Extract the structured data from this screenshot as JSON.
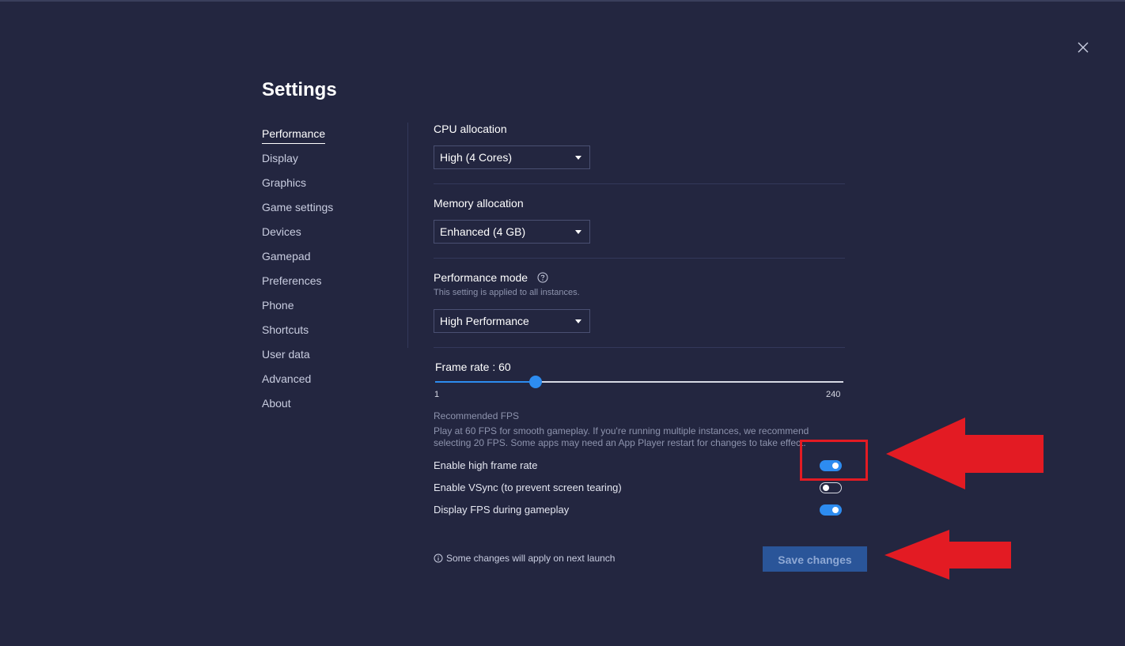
{
  "window": {
    "title": "Settings",
    "close_icon": "close-icon"
  },
  "sidebar": {
    "items": [
      {
        "label": "Performance",
        "active": true
      },
      {
        "label": "Display"
      },
      {
        "label": "Graphics"
      },
      {
        "label": "Game settings"
      },
      {
        "label": "Devices"
      },
      {
        "label": "Gamepad"
      },
      {
        "label": "Preferences"
      },
      {
        "label": "Phone"
      },
      {
        "label": "Shortcuts"
      },
      {
        "label": "User data"
      },
      {
        "label": "Advanced"
      },
      {
        "label": "About"
      }
    ]
  },
  "performance": {
    "cpu": {
      "label": "CPU allocation",
      "value": "High (4 Cores)"
    },
    "memory": {
      "label": "Memory allocation",
      "value": "Enhanced (4 GB)"
    },
    "mode": {
      "label": "Performance mode",
      "help_icon": "help-circle-icon",
      "note": "This setting is applied to all instances.",
      "value": "High Performance"
    },
    "frame_rate": {
      "label": "Frame rate : 60",
      "value": 60,
      "min": 1,
      "max": 240,
      "min_label": "1",
      "max_label": "240"
    },
    "recommended": {
      "title": "Recommended FPS",
      "text": "Play at 60 FPS for smooth gameplay. If you're running multiple instances, we recommend selecting 20 FPS. Some apps may need an App Player restart for changes to take effect."
    },
    "toggles": [
      {
        "label": "Enable high frame rate",
        "on": true
      },
      {
        "label": "Enable VSync (to prevent screen tearing)",
        "on": false
      },
      {
        "label": "Display FPS during gameplay",
        "on": true
      }
    ]
  },
  "footer": {
    "info_icon": "info-circle-icon",
    "info_text": "Some changes will apply on next launch",
    "save_label": "Save changes"
  },
  "colors": {
    "background": "#232640",
    "accent": "#2d8cf0",
    "annotation": "#e31b23",
    "save_button": "#2a5599"
  }
}
